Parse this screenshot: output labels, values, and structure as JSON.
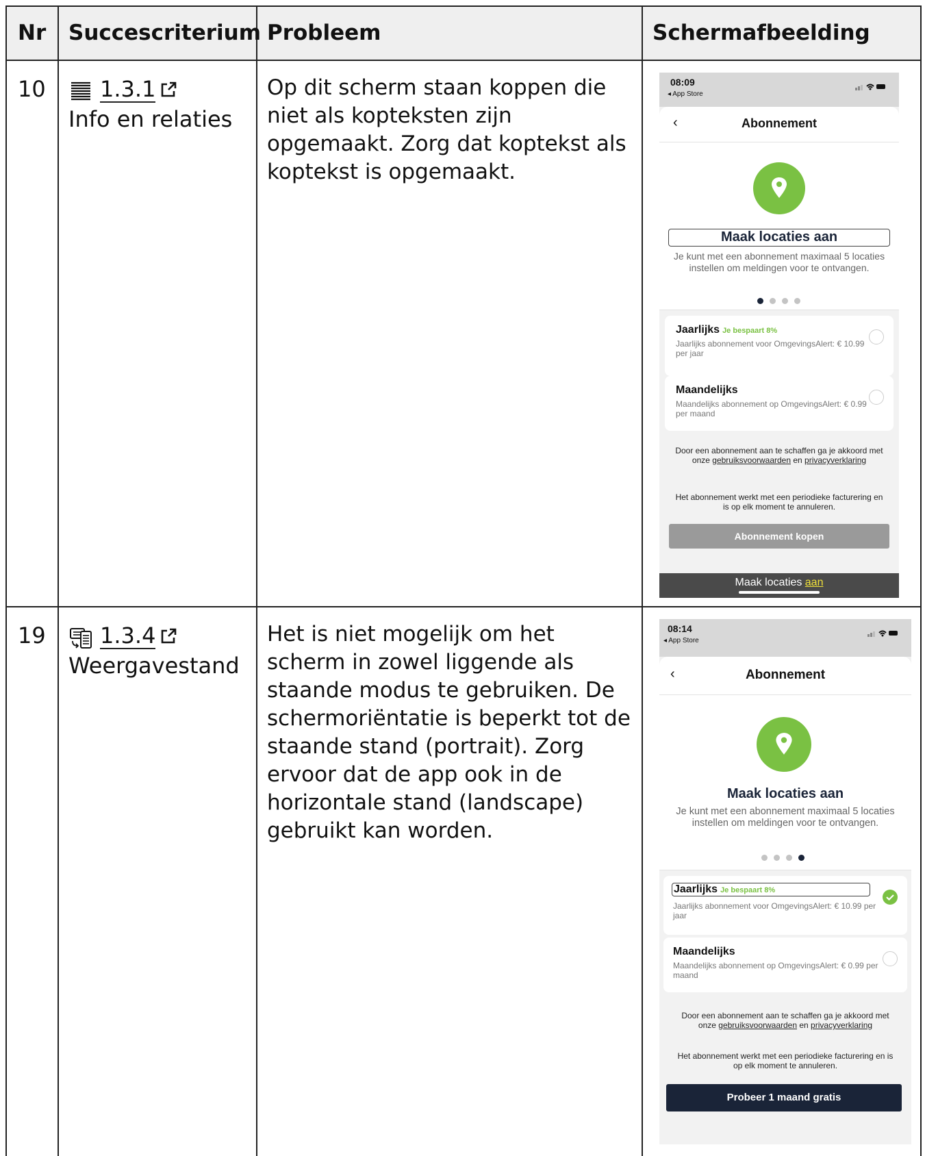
{
  "headers": {
    "nr": "Nr",
    "criterion": "Succescriterium",
    "problem": "Probleem",
    "screenshot": "Schermafbeelding"
  },
  "rows": [
    {
      "nr": "10",
      "criterion_icon": "list-icon",
      "criterion_number": "1.3.1",
      "criterion_name": "Info en relaties",
      "problem": "Op dit scherm staan koppen die niet als kopteksten zijn opgemaakt. Zorg dat koptekst als koptekst is opgemaakt.",
      "phone": {
        "time": "08:09",
        "back_app": "◂ App Store",
        "nav_title": "Abonnement",
        "heading": "Maak locaties aan",
        "subtext": "Je kunt met een abonnement maximaal 5 locaties instellen om meldingen voor te ontvangen.",
        "active_dot": 0,
        "plans": [
          {
            "name": "Jaarlijks",
            "save": "Je bespaart 8%",
            "desc": "Jaarlijks abonnement voor OmgevingsAlert: € 10.99 per jaar",
            "checked": false
          },
          {
            "name": "Maandelijks",
            "save": "",
            "desc": "Maandelijks abonnement op OmgevingsAlert: € 0.99 per maand",
            "checked": false
          }
        ],
        "legal_1a": "Door een abonnement aan te schaffen ga je akkoord met onze ",
        "legal_link1": "gebruiksvoorwaarden",
        "legal_1b": " en ",
        "legal_link2": "privacyverklaring",
        "legal_2": "Het abonnement werkt met een periodieke facturering en is op elk moment te annuleren.",
        "button": "Abonnement kopen",
        "caption_a": "Maak locaties ",
        "caption_b": "aan"
      }
    },
    {
      "nr": "19",
      "criterion_icon": "orientation-icon",
      "criterion_number": "1.3.4",
      "criterion_name": "Weergavestand",
      "problem": "Het is niet mogelijk om het scherm in zowel liggende als staande modus te gebruiken. De schermoriëntatie is beperkt tot de staande stand (portrait). Zorg ervoor dat de app ook in de horizontale stand (landscape) gebruikt kan worden.",
      "phone": {
        "time": "08:14",
        "back_app": "◂ App Store",
        "nav_title": "Abonnement",
        "heading": "Maak locaties aan",
        "subtext": "Je kunt met een abonnement maximaal 5 locaties instellen om meldingen voor te ontvangen.",
        "active_dot": 3,
        "plans": [
          {
            "name": "Jaarlijks",
            "save": "Je bespaart 8%",
            "desc": "Jaarlijks abonnement voor OmgevingsAlert: € 10.99 per jaar",
            "checked": true
          },
          {
            "name": "Maandelijks",
            "save": "",
            "desc": "Maandelijks abonnement op OmgevingsAlert: € 0.99 per maand",
            "checked": false
          }
        ],
        "legal_1a": "Door een abonnement aan te schaffen ga je akkoord met onze ",
        "legal_link1": "gebruiksvoorwaarden",
        "legal_1b": " en ",
        "legal_link2": "privacyverklaring",
        "legal_2": "Het abonnement werkt met een periodieke facturering en is op elk moment te annuleren.",
        "button": "Probeer 1 maand gratis"
      }
    }
  ],
  "colors": {
    "accent_green": "#7ac143",
    "navy": "#1a2438",
    "header_bg": "#efefef",
    "caption_highlight": "#f2e33a"
  }
}
